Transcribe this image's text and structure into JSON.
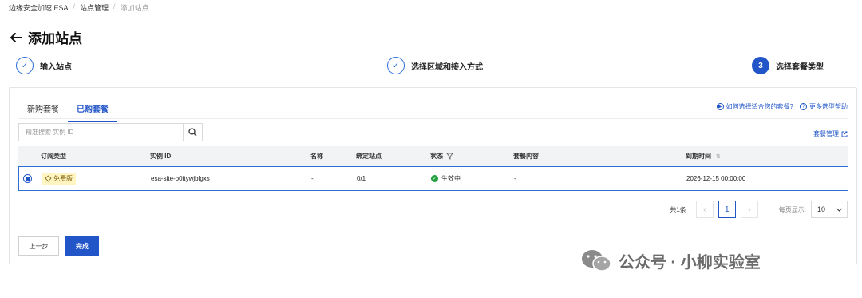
{
  "breadcrumb": {
    "root": "边缘安全加速 ESA",
    "level2": "站点管理",
    "current": "添加站点",
    "sep": "/"
  },
  "page": {
    "title": "添加站点"
  },
  "steps": [
    {
      "label": "输入站点",
      "state": "done"
    },
    {
      "label": "选择区域和接入方式",
      "state": "done"
    },
    {
      "label": "选择套餐类型",
      "state": "active",
      "number": "3"
    }
  ],
  "tabs": [
    {
      "label": "新购套餐",
      "active": false
    },
    {
      "label": "已购套餐",
      "active": true
    }
  ],
  "help": {
    "how_to_choose": "如何选择适合您的套餐?",
    "more_help": "更多选型帮助"
  },
  "search": {
    "placeholder": "精准搜索 实例 ID"
  },
  "manage": {
    "label": "套餐管理"
  },
  "table": {
    "headers": [
      "订阅类型",
      "实例 ID",
      "名称",
      "绑定站点",
      "状态",
      "套餐内容",
      "到期时间"
    ],
    "rows": [
      {
        "type": "免费版",
        "instance_id": "esa-site-b0itywjblgxs",
        "name": "-",
        "bound": "0/1",
        "status": "生效中",
        "content": "-",
        "expire": "2026-12-15 00:00:00",
        "selected": true
      }
    ]
  },
  "pagination": {
    "total": "共1条",
    "current_page": "1",
    "page_size_label": "每页显示:",
    "page_size": "10"
  },
  "footer": {
    "prev": "上一步",
    "done": "完成"
  },
  "watermark": {
    "text": "公众号 · 小柳实验室"
  },
  "colors": {
    "primary": "#2256c8",
    "success": "#23a03f",
    "badge_bg": "#fff5c2"
  }
}
